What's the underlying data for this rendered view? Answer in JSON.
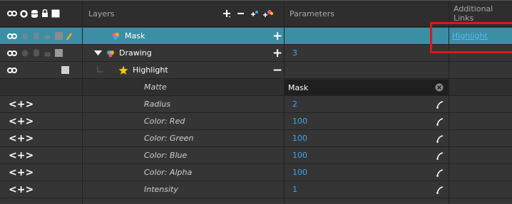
{
  "header": {
    "layers_label": "Layers",
    "parameters_label": "Parameters",
    "additional_links_label": "Additional Links"
  },
  "layers": [
    {
      "name": "Mask",
      "action": "+",
      "param": "",
      "link": "Highlight"
    },
    {
      "name": "Drawing",
      "action": "+",
      "param": "3",
      "link": ""
    },
    {
      "name": "Highlight",
      "action": "−",
      "param": "",
      "link": ""
    }
  ],
  "params": [
    {
      "name": "Matte",
      "value": "Mask",
      "kind": "dropdown"
    },
    {
      "name": "Radius",
      "value": "2",
      "kind": "number"
    },
    {
      "name": "Color: Red",
      "value": "100",
      "kind": "number"
    },
    {
      "name": "Color: Green",
      "value": "100",
      "kind": "number"
    },
    {
      "name": "Color: Blue",
      "value": "100",
      "kind": "number"
    },
    {
      "name": "Color: Alpha",
      "value": "100",
      "kind": "number"
    },
    {
      "name": "Intensity",
      "value": "1",
      "kind": "number"
    }
  ],
  "nav_symbol": "<+>",
  "colors": {
    "selected_row": "#3f8fa2",
    "link": "#5ab6f0",
    "value": "#3ea7ea",
    "annotation": "#d81a1a",
    "star": "#f5c518"
  }
}
